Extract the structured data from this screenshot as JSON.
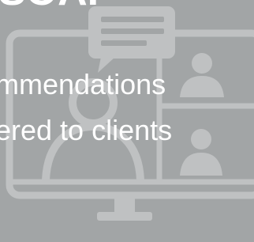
{
  "headline": {
    "top_partial": "SOAP",
    "line1": "mmendations",
    "line2": "ered to clients"
  },
  "illustration": {
    "icon": "desktop-video-call-icon",
    "chat_icon": "chat-bubble-icon",
    "participant_icons": [
      "user-icon",
      "user-icon"
    ]
  },
  "colors": {
    "background": "#a2a5a6",
    "art": "#bfc1c2",
    "text": "#ffffff"
  }
}
